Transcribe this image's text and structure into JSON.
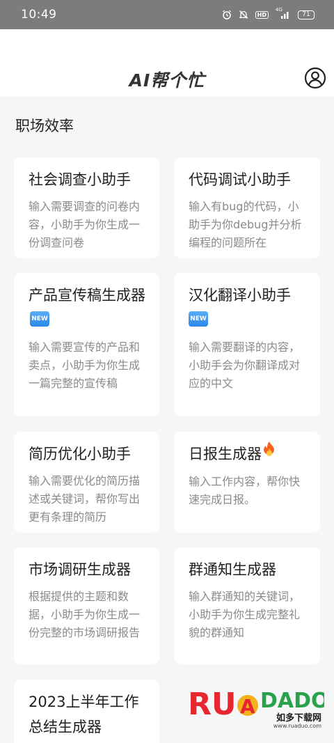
{
  "status_bar": {
    "time": "10:49",
    "hd": "HD",
    "signal": "4G",
    "battery": "71"
  },
  "header": {
    "title": "AI帮个忙"
  },
  "section": {
    "title": "职场效率"
  },
  "cards": [
    {
      "title": "社会调查小助手",
      "desc": "输入需要调查的问卷内容，小助手为你生成一份调查问卷"
    },
    {
      "title": "代码调试小助手",
      "desc": "输入有bug的代码，小助手为你debug并分析编程的问题所在"
    },
    {
      "title": "产品宣传稿生成器",
      "badge": "NEW",
      "desc": "输入需要宣传的产品和卖点，小助手为你生成一篇完整的宣传稿"
    },
    {
      "title": "汉化翻译小助手",
      "badge": "NEW",
      "desc": "输入需要翻译的内容，小助手会为你翻译成对应的中文"
    },
    {
      "title": "简历优化小助手",
      "desc": "输入需要优化的简历描述或关键词，帮你写出更有条理的简历"
    },
    {
      "title": "日报生成器",
      "icon": "fire-icon",
      "desc": "输入工作内容，帮你快速完成日报。"
    },
    {
      "title": "市场调研生成器",
      "desc": "根据提供的主题和数据，小助手为你生成一份完整的市场调研报告"
    },
    {
      "title": "群通知生成器",
      "desc": "输入群通知的关键词，小助手为你生成完整礼貌的群通知"
    },
    {
      "title": "2023上半年工作总结生成器"
    }
  ],
  "watermark": {
    "logo": "RUANDADO",
    "sub": "如多下载网",
    "url": "www.ruaduo.com"
  }
}
